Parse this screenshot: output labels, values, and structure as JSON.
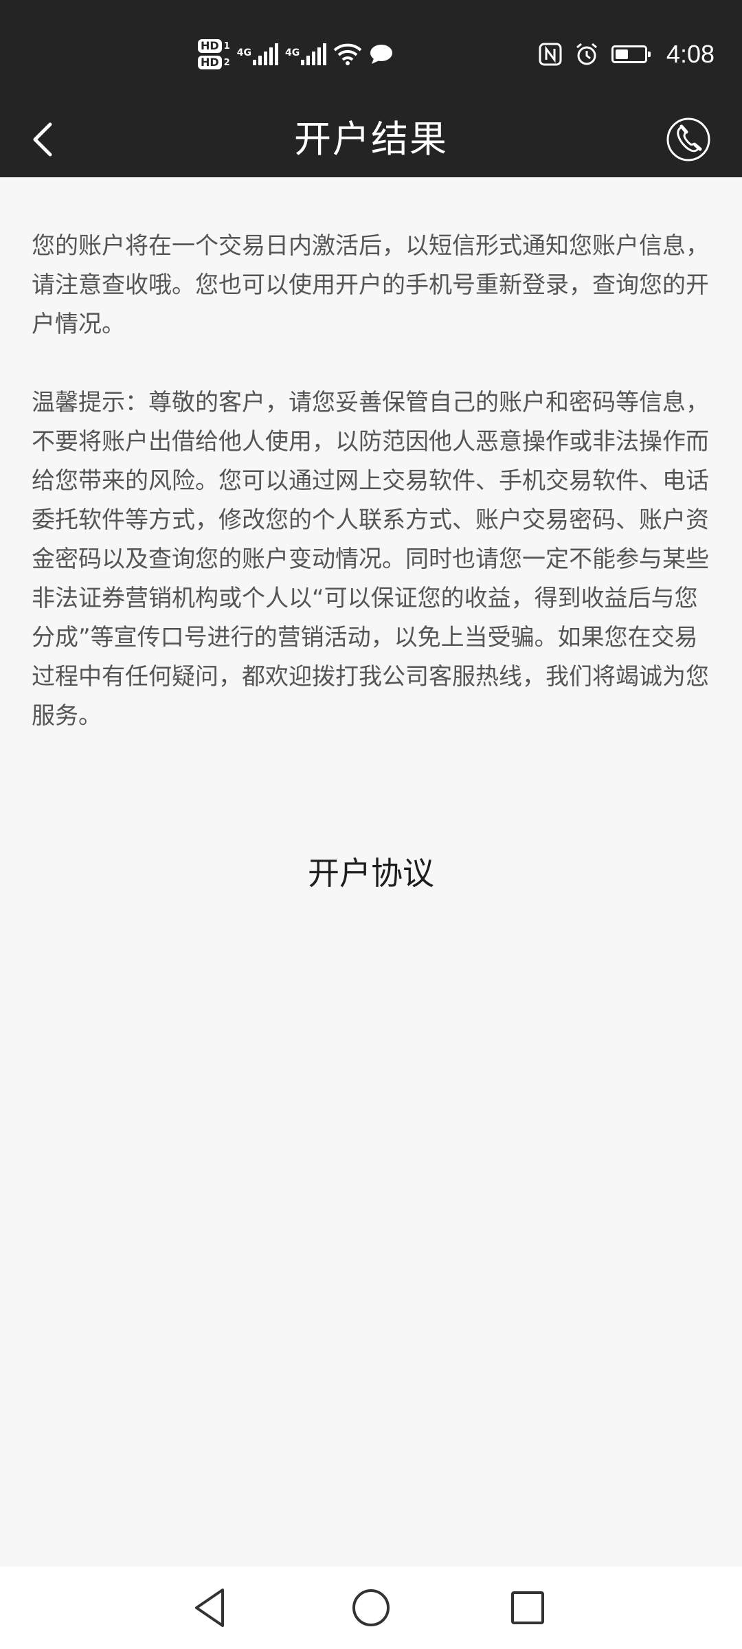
{
  "status_bar": {
    "hd1": "HD",
    "hd1_num": "1",
    "hd2": "HD",
    "hd2_num": "2",
    "sim1_network": "4G",
    "sim2_network": "4G",
    "battery_level": 0.45,
    "time": "4:08",
    "icons": [
      "wifi-icon",
      "message-icon",
      "nfc-icon",
      "alarm-icon",
      "battery-icon"
    ]
  },
  "header": {
    "title": "开户结果",
    "back_icon": "chevron-left-icon",
    "phone_icon": "phone-icon"
  },
  "main": {
    "paragraph1": "您的账户将在一个交易日内激活后，以短信形式通知您账户信息，请注意查收哦。您也可以使用开户的手机号重新登录，查询您的开户情况。",
    "paragraph2": "温馨提示：尊敬的客户，请您妥善保管自己的账户和密码等信息，不要将账户出借给他人使用，以防范因他人恶意操作或非法操作而给您带来的风险。您可以通过网上交易软件、手机交易软件、电话委托软件等方式，修改您的个人联系方式、账户交易密码、账户资金密码以及查询您的账户变动情况。同时也请您一定不能参与某些非法证券营销机构或个人以“可以保证您的收益，得到收益后与您分成”等宣传口号进行的营销活动，以免上当受骗。如果您在交易过程中有任何疑问，都欢迎拨打我公司客服热线，我们将竭诚为您服务。",
    "agreement_link": "开户协议"
  },
  "nav_bar": {
    "back_icon": "triangle-back-icon",
    "home_icon": "circle-home-icon",
    "recents_icon": "square-recents-icon"
  },
  "colors": {
    "bar_background": "#242424",
    "page_background": "#f7f7f7",
    "body_text": "#555555"
  }
}
